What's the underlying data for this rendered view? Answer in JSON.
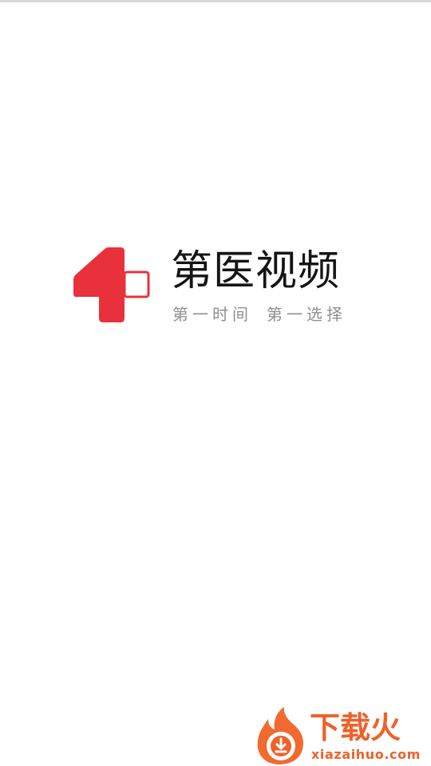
{
  "splash": {
    "brand_name": "第医视频",
    "slogan_part_1": "第一时间",
    "slogan_part_2": "第一选择",
    "logo_icon": "red-medical-cross-one-icon",
    "brand_color": "#e8313b",
    "text_color": "#151515",
    "slogan_color": "#8f8f8f"
  },
  "watermark": {
    "title": "下载火",
    "domain": "xiazaihuo.com",
    "icon": "flame-download-icon",
    "color": "#f0612a"
  }
}
